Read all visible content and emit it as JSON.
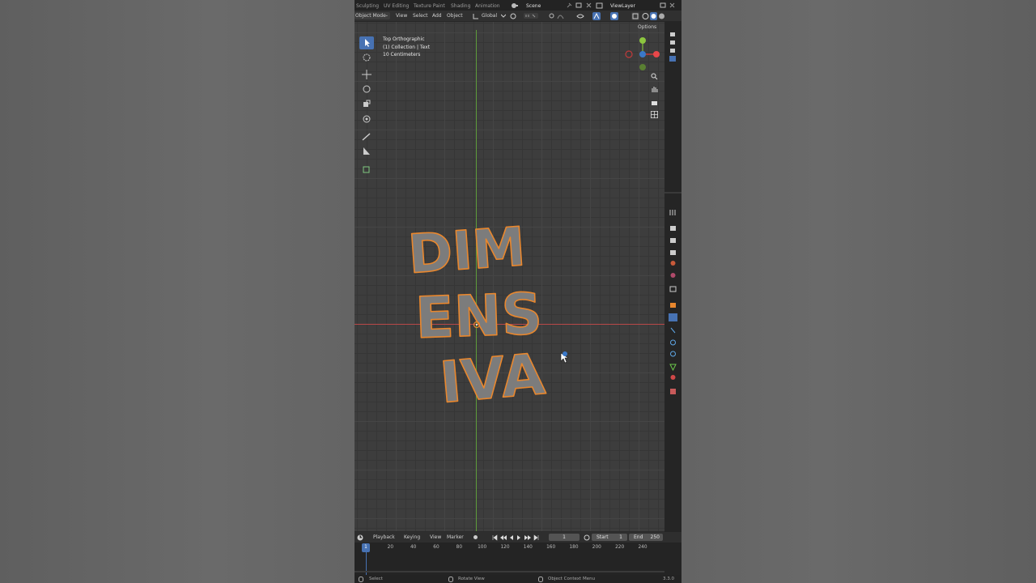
{
  "workspace_tabs": [
    "Sculpting",
    "UV Editing",
    "Texture Paint",
    "Shading",
    "Animation"
  ],
  "scene_name": "Scene",
  "view_layer": "ViewLayer",
  "header": {
    "mode": "Object Mode",
    "menus": [
      "View",
      "Select",
      "Add",
      "Object"
    ],
    "orientation": "Global"
  },
  "options_label": "Options",
  "overlay": {
    "view_name": "Top Orthographic",
    "collection": "(1) Collection | Text",
    "scale": "10 Centimeters"
  },
  "text_object": {
    "lines": [
      "DIM",
      "ENS",
      "IVA"
    ],
    "fill_color": "#7c7c7c",
    "outline_color": "#e8872e"
  },
  "timeline": {
    "menus": [
      "Playback",
      "Keying",
      "View",
      "Marker"
    ],
    "current_frame": "1",
    "start_label": "Start",
    "start": "1",
    "end_label": "End",
    "end": "250",
    "ticks": [
      "1",
      "20",
      "40",
      "60",
      "80",
      "100",
      "120",
      "140",
      "160",
      "180",
      "200",
      "220",
      "240"
    ]
  },
  "status_bar": {
    "select": "Select",
    "rotate": "Rotate View",
    "context": "Object Context Menu",
    "version": "3.3.0"
  },
  "colors": {
    "accent": "#4772b3",
    "x_axis": "#c13a3a",
    "y_axis": "#72a33a"
  }
}
